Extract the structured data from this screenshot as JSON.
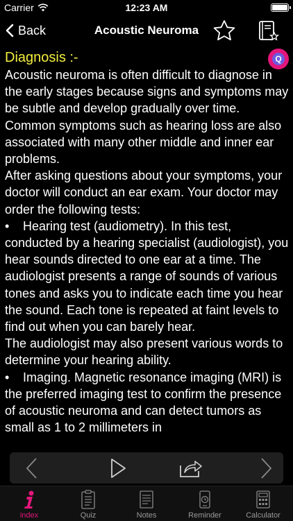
{
  "status_bar": {
    "carrier": "Carrier",
    "time": "12:23 AM"
  },
  "nav": {
    "back_label": "Back",
    "title": "Acoustic Neuroma"
  },
  "quiz_button": {
    "label": "Q"
  },
  "article": {
    "heading": "Diagnosis :-",
    "paragraphs": [
      "Acoustic neuroma is often difficult to diagnose in the early stages because signs and symptoms may be subtle and develop gradually over time. Common symptoms such as hearing loss are also associated with many other middle and inner ear problems.",
      "After asking questions about your symptoms, your doctor will conduct an ear exam. Your doctor may order the following tests:"
    ],
    "bullet_char": "•",
    "bullet1": "Hearing test (audiometry). In this test, conducted by a hearing specialist (audiologist), you hear sounds directed to one ear at a time. The audiologist presents a range of sounds of various tones and asks you to indicate each time you hear the sound. Each tone is repeated at faint levels to find out when you can barely hear.",
    "paragraph3": "The audiologist may also present various words to determine your hearing ability.",
    "bullet2": "Imaging. Magnetic resonance imaging (MRI) is the preferred imaging test to confirm the presence of acoustic neuroma and can detect tumors as small as 1 to 2 millimeters in"
  },
  "media_controls": [
    "chevron-left-icon",
    "play-icon",
    "share-icon",
    "chevron-right-icon"
  ],
  "tabs": [
    {
      "label": "index",
      "icon": "info-icon",
      "active": true
    },
    {
      "label": "Quiz",
      "icon": "quiz-icon",
      "active": false
    },
    {
      "label": "Notes",
      "icon": "notes-icon",
      "active": false
    },
    {
      "label": "Reminder",
      "icon": "reminder-icon",
      "active": false
    },
    {
      "label": "Calculator",
      "icon": "calculator-icon",
      "active": false
    }
  ],
  "colors": {
    "heading": "#f3ef3f",
    "accent": "#e3167b",
    "background": "#000000"
  }
}
